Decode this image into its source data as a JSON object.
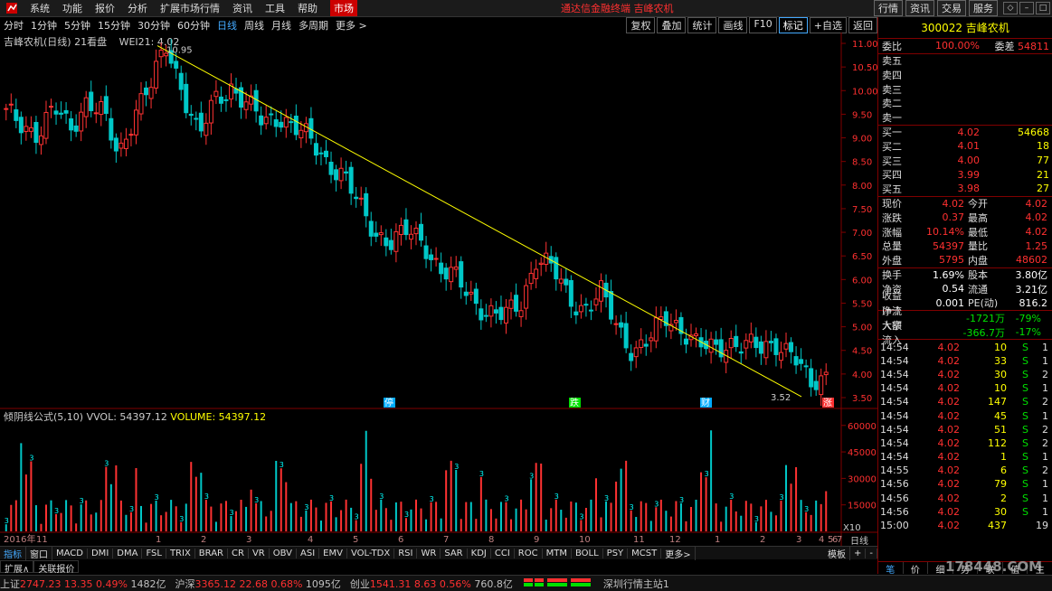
{
  "menu": {
    "items": [
      "系统",
      "功能",
      "报价",
      "分析",
      "扩展市场行情",
      "资讯",
      "工具",
      "帮助"
    ],
    "active": "市场",
    "center_title": "通达信金融终端  吉峰农机",
    "right_buttons": [
      "行情",
      "资讯",
      "交易",
      "服务"
    ]
  },
  "toolbar": {
    "periods": [
      "分时",
      "1分钟",
      "5分钟",
      "15分钟",
      "30分钟",
      "60分钟",
      "日线",
      "周线",
      "月线",
      "多周期",
      "更多 >"
    ],
    "selected_period": "日线",
    "tools": [
      "复权",
      "叠加",
      "统计",
      "画线",
      "F10",
      "标记",
      "+自选",
      "返回"
    ]
  },
  "chart": {
    "title": "吉峰农机(日线)",
    "subtitle": "21看盘",
    "wei": "WEI21: 4.02",
    "high_label": "10.95",
    "low_label": "3.52",
    "yticks": [
      "11.00",
      "10.50",
      "10.00",
      "9.50",
      "9.00",
      "8.50",
      "8.00",
      "7.50",
      "7.00",
      "6.50",
      "6.00",
      "5.50",
      "5.00",
      "4.50",
      "4.00",
      "3.50"
    ],
    "markers": [
      "停",
      "跌",
      "财",
      "涨"
    ],
    "xticks": [
      "2016年",
      "11",
      "1",
      "2",
      "3",
      "4",
      "5",
      "6",
      "7",
      "8",
      "9",
      "10",
      "11",
      "12",
      "1",
      "2",
      "3",
      "4",
      "5",
      "6",
      "7"
    ],
    "vol_title": "倾阴线公式(5,10)",
    "vol_label": "VVOL: 54397.12",
    "volume_label": "VOLUME: 54397.12",
    "vol_yticks": [
      "60000",
      "45000",
      "30000",
      "15000"
    ],
    "vol_unit": "X10",
    "period_label": "日线"
  },
  "chart_data": {
    "type": "candlestick",
    "title": "吉峰农机(日线)",
    "ylim": [
      3.5,
      11.0
    ],
    "trendline": {
      "from": 10.95,
      "to": 3.52
    },
    "close_approx": [
      9.5,
      9.3,
      9.1,
      9.6,
      9.2,
      9.8,
      9.5,
      8.6,
      9.6,
      10.1,
      10.95,
      10.0,
      9.0,
      9.8,
      10.1,
      9.7,
      9.3,
      9.5,
      9.2,
      8.9,
      8.5,
      8.2,
      7.5,
      7.0,
      6.8,
      7.0,
      6.8,
      6.2,
      6.0,
      5.6,
      5.3,
      5.2,
      5.5,
      6.5,
      6.2,
      5.6,
      5.4,
      5.7,
      5.0,
      4.5,
      4.7,
      5.2,
      5.0,
      4.6,
      4.5,
      4.7,
      4.6,
      4.5,
      4.7,
      4.4,
      3.7,
      4.02
    ]
  },
  "quote": {
    "code_name": "300022 吉峰农机",
    "weibi_label": "委比",
    "weibi": "100.00%",
    "weicha_label": "委差",
    "weicha": "54811",
    "sells": [
      {
        "label": "卖五",
        "price": "",
        "vol": ""
      },
      {
        "label": "卖四",
        "price": "",
        "vol": ""
      },
      {
        "label": "卖三",
        "price": "",
        "vol": ""
      },
      {
        "label": "卖二",
        "price": "",
        "vol": ""
      },
      {
        "label": "卖一",
        "price": "",
        "vol": ""
      }
    ],
    "buys": [
      {
        "label": "买一",
        "price": "4.02",
        "vol": "54668"
      },
      {
        "label": "买二",
        "price": "4.01",
        "vol": "18"
      },
      {
        "label": "买三",
        "price": "4.00",
        "vol": "77"
      },
      {
        "label": "买四",
        "price": "3.99",
        "vol": "21"
      },
      {
        "label": "买五",
        "price": "3.98",
        "vol": "27"
      }
    ],
    "stats": [
      {
        "l1": "现价",
        "v1": "4.02",
        "l2": "今开",
        "v2": "4.02"
      },
      {
        "l1": "涨跌",
        "v1": "0.37",
        "l2": "最高",
        "v2": "4.02"
      },
      {
        "l1": "涨幅",
        "v1": "10.14%",
        "l2": "最低",
        "v2": "4.02"
      },
      {
        "l1": "总量",
        "v1": "54397",
        "l2": "量比",
        "v2": "1.25"
      },
      {
        "l1": "外盘",
        "v1": "5795",
        "l2": "内盘",
        "v2": "48602"
      }
    ],
    "fund": [
      {
        "l1": "换手",
        "v1": "1.69%",
        "l2": "股本",
        "v2": "3.80亿"
      },
      {
        "l1": "净资",
        "v1": "0.54",
        "l2": "流通",
        "v2": "3.21亿"
      },
      {
        "l1": "收益(一)",
        "v1": "0.001",
        "l2": "PE(动)",
        "v2": "816.2"
      }
    ],
    "flows": [
      {
        "label": "净流入额",
        "val": "-1721万",
        "pct": "-79%"
      },
      {
        "label": "大宗流入",
        "val": "-366.7万",
        "pct": "-17%"
      }
    ],
    "ticks": [
      {
        "t": "14:54",
        "p": "4.02",
        "q": "10",
        "s": "S",
        "n": "1"
      },
      {
        "t": "14:54",
        "p": "4.02",
        "q": "33",
        "s": "S",
        "n": "1"
      },
      {
        "t": "14:54",
        "p": "4.02",
        "q": "30",
        "s": "S",
        "n": "2"
      },
      {
        "t": "14:54",
        "p": "4.02",
        "q": "10",
        "s": "S",
        "n": "1"
      },
      {
        "t": "14:54",
        "p": "4.02",
        "q": "147",
        "s": "S",
        "n": "2"
      },
      {
        "t": "14:54",
        "p": "4.02",
        "q": "45",
        "s": "S",
        "n": "1"
      },
      {
        "t": "14:54",
        "p": "4.02",
        "q": "51",
        "s": "S",
        "n": "2"
      },
      {
        "t": "14:54",
        "p": "4.02",
        "q": "112",
        "s": "S",
        "n": "2"
      },
      {
        "t": "14:54",
        "p": "4.02",
        "q": "1",
        "s": "S",
        "n": "1"
      },
      {
        "t": "14:55",
        "p": "4.02",
        "q": "6",
        "s": "S",
        "n": "2"
      },
      {
        "t": "14:56",
        "p": "4.02",
        "q": "79",
        "s": "S",
        "n": "1"
      },
      {
        "t": "14:56",
        "p": "4.02",
        "q": "2",
        "s": "S",
        "n": "1"
      },
      {
        "t": "14:56",
        "p": "4.02",
        "q": "30",
        "s": "S",
        "n": "1"
      },
      {
        "t": "15:00",
        "p": "4.02",
        "q": "437",
        "s": "",
        "n": "19"
      }
    ],
    "tabs": [
      "笔",
      "价",
      "细",
      "势",
      "联",
      "值",
      "主"
    ]
  },
  "bottom_tabs": [
    "指标",
    "窗口",
    "MACD",
    "DMI",
    "DMA",
    "FSL",
    "TRIX",
    "BRAR",
    "CR",
    "VR",
    "OBV",
    "ASI",
    "EMV",
    "VOL-TDX",
    "RSI",
    "WR",
    "SAR",
    "KDJ",
    "CCI",
    "ROC",
    "MTM",
    "BOLL",
    "PSY",
    "MCST",
    "更多>"
  ],
  "bottom_right": [
    "模板",
    "+",
    "-"
  ],
  "sub_tabs": [
    "扩展∧",
    "关联报价"
  ],
  "status": {
    "sh_label": "上证",
    "sh_val": "2747.23",
    "sh_chg": "13.35",
    "sh_pct": "0.49%",
    "sh_amt": "1482亿",
    "sz_label": "沪深",
    "sz_val": "3365.12",
    "sz_chg": "22.68",
    "sz_pct": "0.68%",
    "sz_amt": "1095亿",
    "cy_label": "创业",
    "cy_val": "1541.31",
    "cy_chg": "8.63",
    "cy_pct": "0.56%",
    "cy_amt": "760.8亿",
    "server": "深圳行情主站1"
  },
  "watermark": "178448.COM"
}
